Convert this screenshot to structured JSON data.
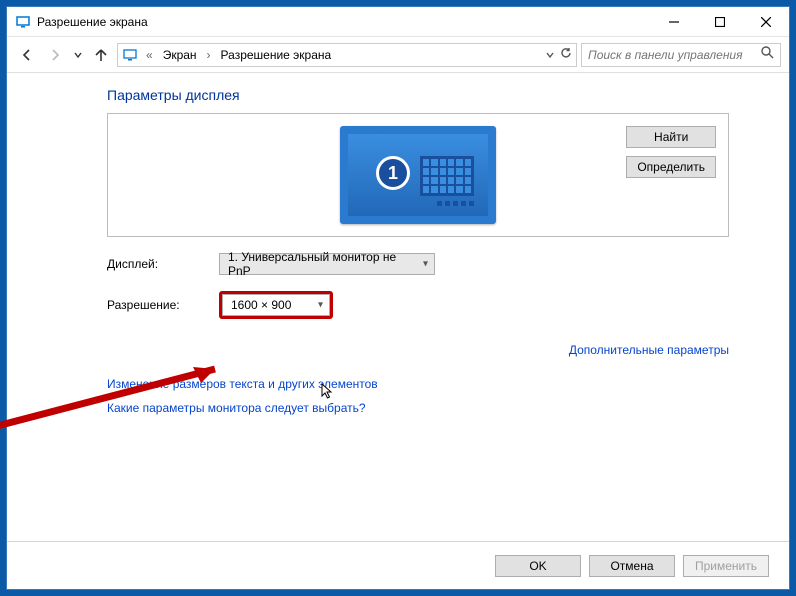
{
  "window": {
    "title": "Разрешение экрана",
    "buttons": {
      "minimize": "—",
      "maximize": "▢",
      "close": "✕"
    }
  },
  "nav": {
    "crumb1": "Экран",
    "crumb2": "Разрешение экрана",
    "search_placeholder": "Поиск в панели управления"
  },
  "main": {
    "heading": "Параметры дисплея",
    "monitor_number": "1",
    "find_btn": "Найти",
    "identify_btn": "Определить",
    "display_label": "Дисплей:",
    "display_value": "1. Универсальный монитор не PnP",
    "resolution_label": "Разрешение:",
    "resolution_value": "1600 × 900",
    "advanced_link": "Дополнительные параметры",
    "link_text_size": "Изменение размеров текста и других элементов",
    "link_which_settings": "Какие параметры монитора следует выбрать?"
  },
  "footer": {
    "ok": "OK",
    "cancel": "Отмена",
    "apply": "Применить"
  }
}
